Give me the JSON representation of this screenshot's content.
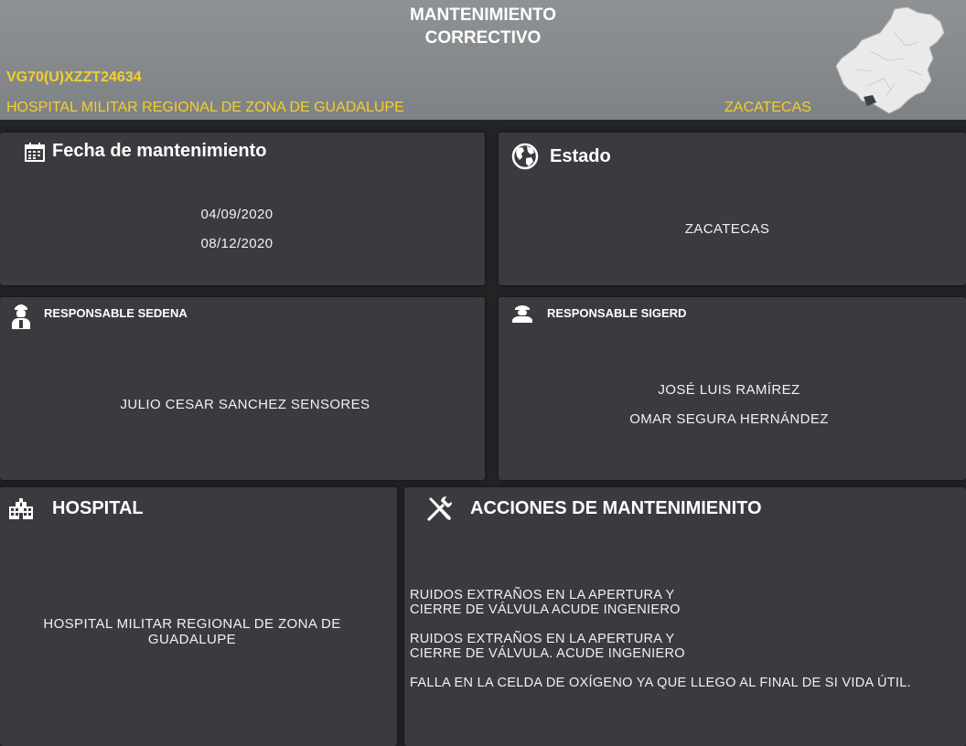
{
  "header": {
    "title_line1": "MANTENIMIENTO",
    "title_line2": "CORRECTIVO",
    "code": "VG70(U)XZZT24634",
    "hospital": "HOSPITAL MILITAR REGIONAL DE ZONA DE GUADALUPE",
    "state": "ZACATECAS",
    "map_icon": "zacatecas-map"
  },
  "fecha": {
    "title": "Fecha de mantenimiento",
    "icon": "calendar-icon",
    "dates": [
      "04/09/2020",
      "08/12/2020"
    ]
  },
  "estado": {
    "title": "Estado",
    "icon": "globe-icon",
    "value": "ZACATECAS"
  },
  "sedena": {
    "title": "RESPONSABLE SEDENA",
    "icon": "soldier-icon",
    "value": "JULIO CESAR SANCHEZ SENSORES"
  },
  "sigerd": {
    "title": "RESPONSABLE SIGERD",
    "icon": "officer-icon",
    "names": [
      "JOSÉ LUIS RAMÍREZ",
      "OMAR SEGURA HERNÁNDEZ"
    ]
  },
  "hospital": {
    "title": "HOSPITAL",
    "icon": "hospital-icon",
    "value": "HOSPITAL MILITAR REGIONAL DE ZONA DE GUADALUPE"
  },
  "acciones": {
    "title": "ACCIONES DE MANTENIMIENITO",
    "icon": "tools-icon",
    "items": [
      "RUIDOS EXTRAÑOS EN LA APERTURA Y CIERRE DE VÁLVULA  ACUDE INGENIERO",
      "RUIDOS EXTRAÑOS EN LA APERTURA Y CIERRE DE VÁLVULA.  ACUDE INGENIERO",
      "FALLA EN LA CELDA DE OXÍGENO YA QUE LLEGO AL FINAL DE SI VIDA ÚTIL."
    ]
  },
  "colors": {
    "header_bg": "#8a8d8f",
    "accent_yellow": "#f2cf2e",
    "panel_bg": "#393b3e",
    "page_bg": "#232426"
  }
}
